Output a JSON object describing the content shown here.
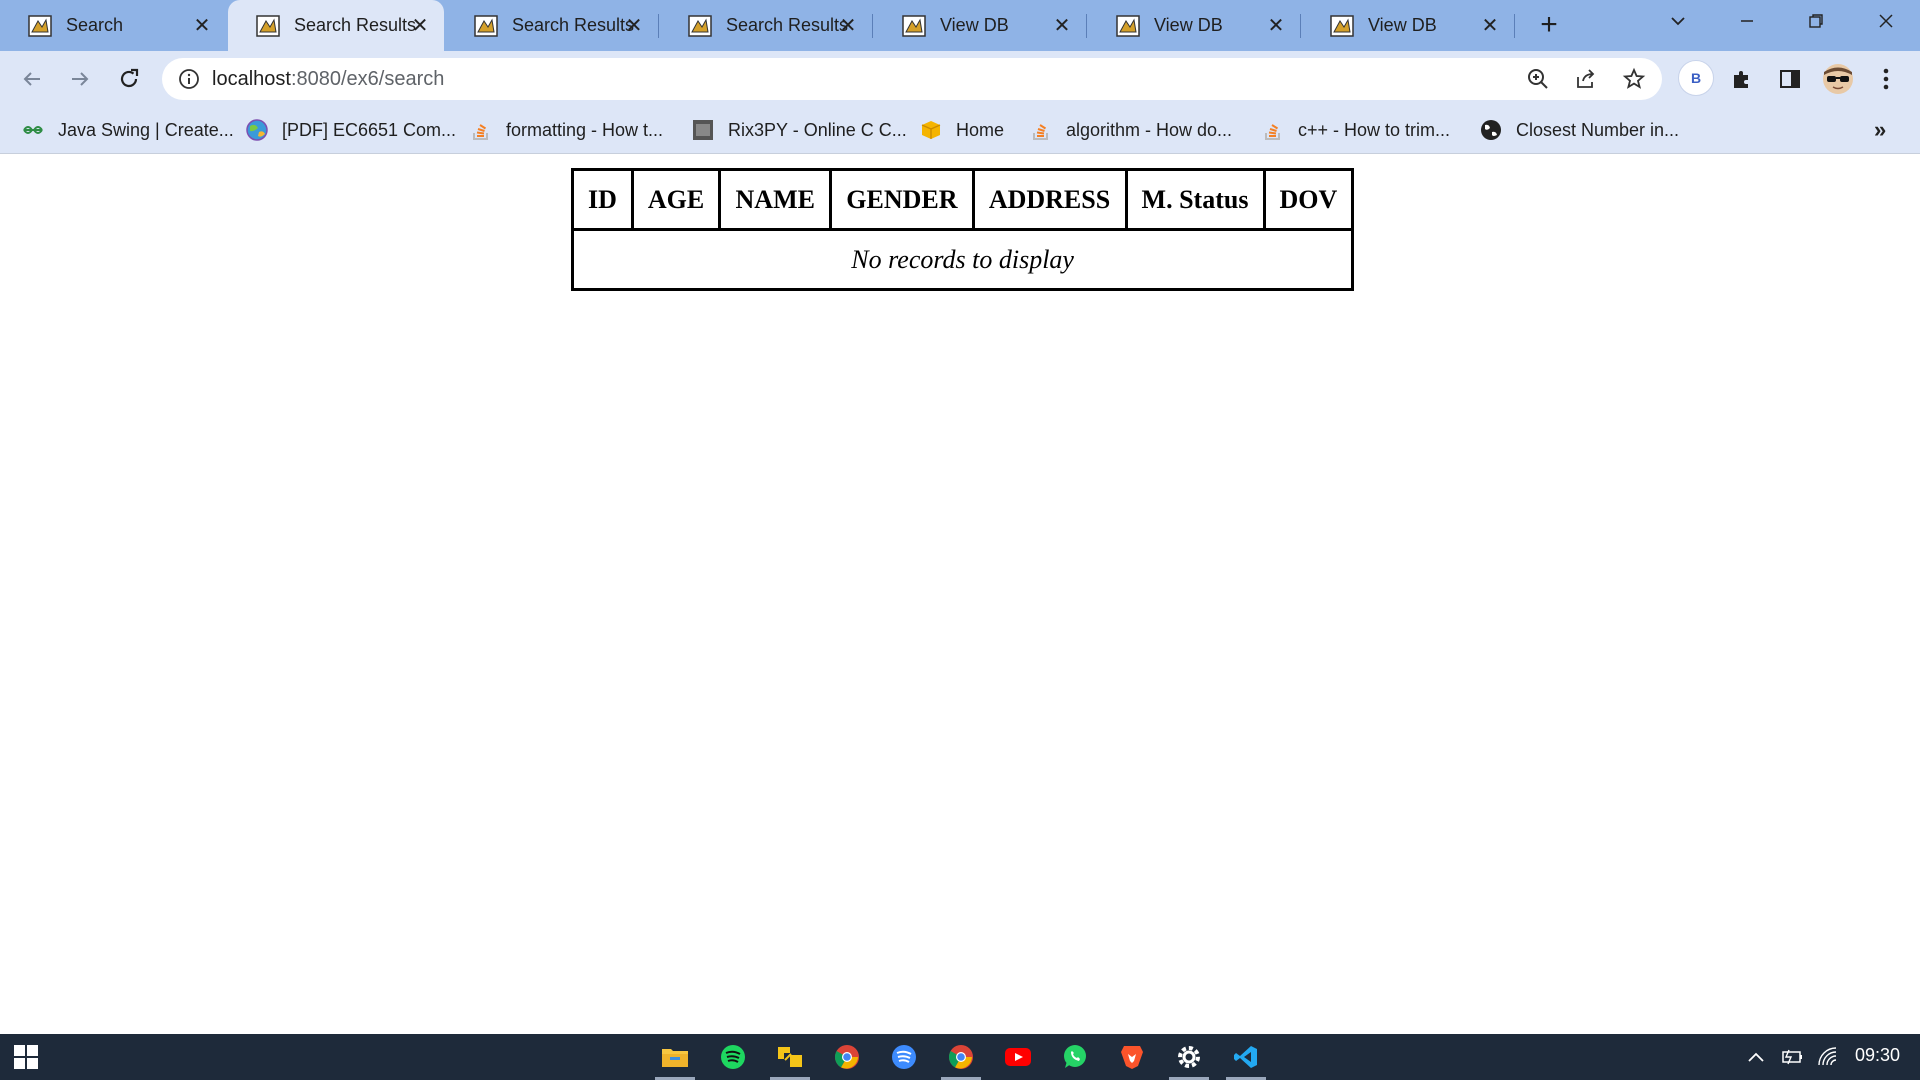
{
  "browser": {
    "tabs": [
      {
        "title": "Search",
        "active": false
      },
      {
        "title": "Search Results",
        "active": true
      },
      {
        "title": "Search Results",
        "active": false
      },
      {
        "title": "Search Results",
        "active": false
      },
      {
        "title": "View DB",
        "active": false
      },
      {
        "title": "View DB",
        "active": false
      },
      {
        "title": "View DB",
        "active": false
      }
    ],
    "new_tab_label": "+",
    "address": {
      "host": "localhost",
      "path": ":8080/ex6/search"
    },
    "profile_initial": "B",
    "bookmarks": [
      {
        "label": "Java Swing | Create...",
        "icon": "gfg-icon"
      },
      {
        "label": "[PDF] EC6651 Com...",
        "icon": "globe-colorful-icon"
      },
      {
        "label": "formatting - How t...",
        "icon": "stackoverflow-icon"
      },
      {
        "label": "Rix3PY - Online C C...",
        "icon": "ideone-icon"
      },
      {
        "label": "Home",
        "icon": "box-icon"
      },
      {
        "label": "algorithm - How do...",
        "icon": "stackoverflow-icon"
      },
      {
        "label": "c++ - How to trim...",
        "icon": "stackoverflow-icon"
      },
      {
        "label": "Closest Number in...",
        "icon": "globe-icon"
      }
    ],
    "bookmarks_more": "»"
  },
  "page": {
    "table": {
      "headers": [
        "ID",
        "AGE",
        "NAME",
        "GENDER",
        "ADDRESS",
        "M. Status",
        "DOV"
      ],
      "empty_message": "No records to display"
    }
  },
  "taskbar": {
    "apps": [
      "file-explorer-icon",
      "spotify-icon",
      "app-icon",
      "chrome-icon",
      "spotify-alt-icon",
      "chrome-active-icon",
      "youtube-icon",
      "whatsapp-icon",
      "brave-icon",
      "settings-icon",
      "vscode-icon"
    ],
    "clock": "09:30"
  },
  "colors": {
    "tabstrip": "#8fb3e6",
    "toolbar": "#dde6f7",
    "taskbar": "#1e2a3a"
  }
}
